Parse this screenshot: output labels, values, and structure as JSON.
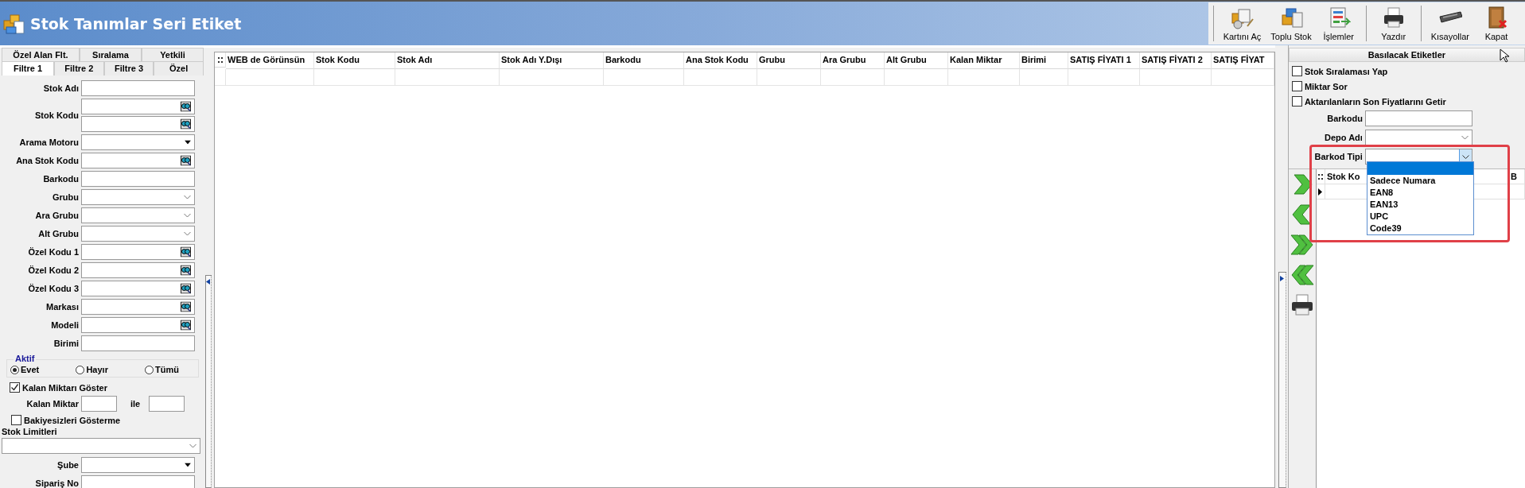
{
  "window": {
    "title": "Stok Tanımlar Seri Etiket"
  },
  "toolbar": [
    {
      "label": "Kartını Aç",
      "kind": "open_card",
      "group_start": true
    },
    {
      "label": "Toplu Stok",
      "kind": "bulk",
      "group_start": false
    },
    {
      "label": "İşlemler",
      "kind": "operations",
      "group_start": false
    },
    {
      "label": "Yazdır",
      "kind": "print",
      "group_start": true
    },
    {
      "label": "Kısayollar",
      "kind": "keyboard",
      "group_start": true
    },
    {
      "label": "Kapat",
      "kind": "close",
      "group_start": false
    }
  ],
  "filter_panel": {
    "tab_rows": [
      [
        {
          "label": "Özel Alan Flt.",
          "selected": false
        },
        {
          "label": "Sıralama",
          "selected": false
        },
        {
          "label": "Yetkili",
          "selected": false
        }
      ],
      [
        {
          "label": "Filtre 1",
          "selected": true
        },
        {
          "label": "Filtre 2",
          "selected": false
        },
        {
          "label": "Filtre 3",
          "selected": false
        },
        {
          "label": "Özel",
          "selected": false
        }
      ]
    ],
    "fields": [
      {
        "label": "Stok Adı",
        "kind": "text"
      },
      {
        "label": "Stok Kodu",
        "kind": "lookup_pair"
      },
      {
        "label": "Arama Motoru",
        "kind": "dropdown"
      },
      {
        "label": "Ana Stok Kodu",
        "kind": "lookup"
      },
      {
        "label": "Barkodu",
        "kind": "text"
      },
      {
        "label": "Grubu",
        "kind": "combo"
      },
      {
        "label": "Ara Grubu",
        "kind": "combo"
      },
      {
        "label": "Alt Grubu",
        "kind": "combo"
      },
      {
        "label": "Özel Kodu 1",
        "kind": "lookup"
      },
      {
        "label": "Özel Kodu 2",
        "kind": "lookup"
      },
      {
        "label": "Özel Kodu 3",
        "kind": "lookup"
      },
      {
        "label": "Markası",
        "kind": "lookup"
      },
      {
        "label": "Modeli",
        "kind": "lookup"
      },
      {
        "label": "Birimi",
        "kind": "text"
      }
    ],
    "active": {
      "title": "Aktif",
      "options": [
        {
          "label": "Evet",
          "selected": true
        },
        {
          "label": "Hayır",
          "selected": false
        },
        {
          "label": "Tümü",
          "selected": false
        }
      ]
    },
    "show_remaining": {
      "label": "Kalan Miktarı Göster",
      "checked": true
    },
    "remaining_range": {
      "label": "Kalan Miktar",
      "joiner": "ile"
    },
    "hide_zero_balance": {
      "label": "Bakiyesizleri Gösterme",
      "checked": false
    },
    "stock_limits": {
      "label": "Stok Limitleri"
    },
    "lower_fields": [
      {
        "label": "Şube",
        "kind": "dropdown"
      },
      {
        "label": "Sipariş No",
        "kind": "text"
      }
    ]
  },
  "grid": {
    "columns": [
      "WEB de Görünsün",
      "Stok Kodu",
      "Stok Adı",
      "Stok Adı Y.Dışı",
      "Barkodu",
      "Ana Stok Kodu",
      "Grubu",
      "Ara Grubu",
      "Alt Grubu",
      "Kalan Miktar",
      "Birimi",
      "SATIŞ FİYATI  1",
      "SATIŞ FİYATI  2",
      "SATIŞ FİYAT"
    ]
  },
  "label_panel": {
    "title": "Basılacak Etiketler",
    "options": [
      {
        "label": "Stok Sıralaması Yap",
        "checked": false
      },
      {
        "label": "Miktar Sor",
        "checked": false
      },
      {
        "label": "Aktarılanların Son Fiyatlarını Getir",
        "checked": false
      }
    ],
    "fields": [
      {
        "label": "Barkodu",
        "kind": "text"
      },
      {
        "label": "Depo Adı",
        "kind": "combo"
      }
    ],
    "barcode_type": {
      "label": "Barkod Tipi",
      "open": true,
      "highlighted": true,
      "blank_selected": true,
      "options": [
        {
          "label": "Sadece Numara",
          "selected": false
        },
        {
          "label": "EAN8",
          "selected": false
        },
        {
          "label": "EAN13",
          "selected": false
        },
        {
          "label": "UPC",
          "selected": false
        },
        {
          "label": "Code39",
          "selected": false
        }
      ]
    },
    "actions": [
      {
        "kind": "add"
      },
      {
        "kind": "remove"
      },
      {
        "kind": "add_all"
      },
      {
        "kind": "remove_all"
      },
      {
        "kind": "print"
      }
    ],
    "grid": {
      "columns": [
        "Stok Ko",
        "B"
      ]
    }
  }
}
